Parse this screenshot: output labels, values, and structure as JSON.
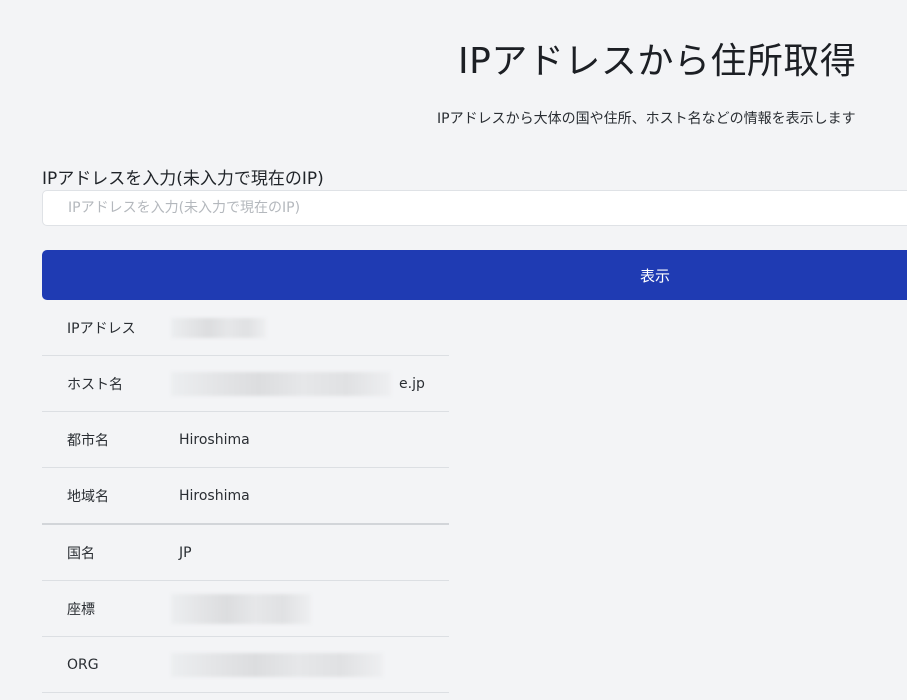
{
  "header": {
    "title": "IPアドレスから住所取得",
    "subtitle": "IPアドレスから大体の国や住所、ホスト名などの情報を表示します"
  },
  "form": {
    "label": "IPアドレスを入力(未入力で現在のIP)",
    "input_value": "",
    "placeholder": "IPアドレスを入力(未入力で現在のIP)",
    "submit_label": "表示"
  },
  "results": {
    "ip_label": "IPアドレス",
    "host_label": "ホスト名",
    "host_value_visible": "e.jp",
    "city_label": "都市名",
    "city_value": "Hiroshima",
    "region_label": "地域名",
    "region_value": "Hiroshima",
    "country_label": "国名",
    "country_value": "JP",
    "coords_label": "座標",
    "org_label": "ORG"
  }
}
